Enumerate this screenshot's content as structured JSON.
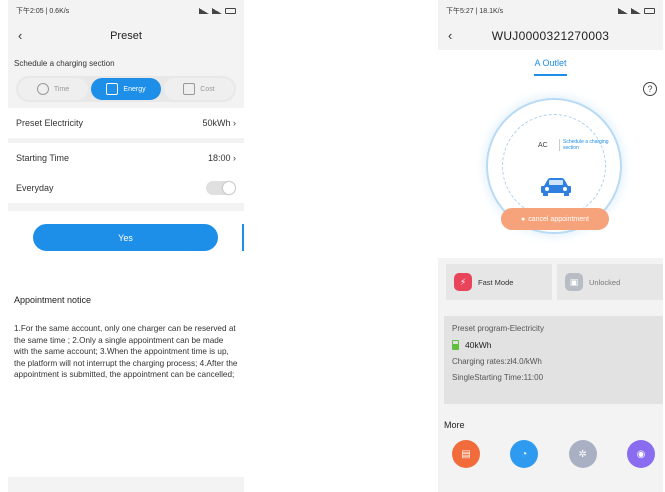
{
  "left": {
    "status": {
      "time": "下午2:05 | 0.6K/s"
    },
    "title": "Preset",
    "section_label": "Schedule a charging section",
    "segments": [
      {
        "label": "Time",
        "icon": "clock-icon"
      },
      {
        "label": "Energy",
        "icon": "battery-icon"
      },
      {
        "label": "Cost",
        "icon": "wallet-icon"
      }
    ],
    "selected_segment": "Energy",
    "preset_electricity": {
      "label": "Preset Electricity",
      "value": "50kWh"
    },
    "starting_time": {
      "label": "Starting Time",
      "value": "18:00"
    },
    "everyday": {
      "label": "Everyday",
      "enabled": false
    },
    "yes_label": "Yes",
    "notice": {
      "title": "Appointment notice",
      "text": "1.For the same account, only one charger can be reserved at the same time ; 2.Only a single appointment can be made with the same account; 3.When the appointment time is up, the platform will not interrupt the charging process; 4.After the appointment is submitted, the appointment can be cancelled;"
    }
  },
  "right": {
    "status": {
      "time": "下午5:27 | 18.1K/s"
    },
    "title": "WUJ0000321270003",
    "tab": "A Outlet",
    "ac_label": "AC",
    "schedule_label": "Schedule a charging section",
    "cancel_label": "cancel appointment",
    "modes": [
      {
        "label": "Fast Mode",
        "color": "#e8455a"
      },
      {
        "label": "Unlocked",
        "color": "#b8bcc4"
      }
    ],
    "preset": {
      "title": "Preset program-Electricity",
      "kwh": "40kWh",
      "rate": "Charging rates:zł4.0/kWh",
      "start": "SingleStarting Time:11:00"
    },
    "more_label": "More",
    "more_icons": [
      {
        "name": "record-icon",
        "color": "#f26b3a"
      },
      {
        "name": "chart-icon",
        "color": "#2f9bf0"
      },
      {
        "name": "settings-icon",
        "color": "#a9b0c4"
      },
      {
        "name": "scan-icon",
        "color": "#8a6cf0"
      }
    ]
  },
  "colors": {
    "accent": "#1e8fe8",
    "cancel": "#f6a27b"
  }
}
